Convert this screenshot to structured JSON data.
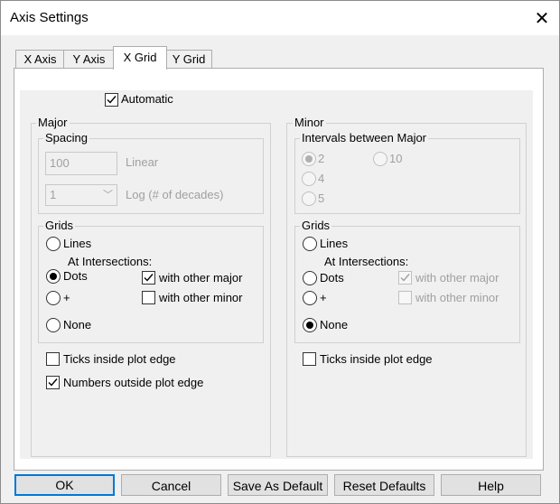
{
  "window": {
    "title": "Axis Settings"
  },
  "tabs": [
    {
      "label": "X Axis"
    },
    {
      "label": "Y Axis"
    },
    {
      "label": "X Grid"
    },
    {
      "label": "Y Grid"
    }
  ],
  "automatic": {
    "label": "Automatic",
    "checked": true
  },
  "major": {
    "title": "Major",
    "spacing": {
      "title": "Spacing",
      "linear_value": "100",
      "linear_label": "Linear",
      "log_value": "1",
      "log_label": "Log (# of decades)"
    },
    "grids": {
      "title": "Grids",
      "lines": "Lines",
      "at_intersections": "At Intersections:",
      "dots": "Dots",
      "plus": "+",
      "none": "None",
      "with_other_major": "with other major",
      "with_other_minor": "with other minor",
      "selected": "Dots"
    },
    "ticks_inside": "Ticks inside plot edge",
    "numbers_outside": "Numbers outside plot edge"
  },
  "minor": {
    "title": "Minor",
    "intervals": {
      "title": "Intervals between Major",
      "options": [
        "2",
        "4",
        "5",
        "10"
      ],
      "selected": "2"
    },
    "grids": {
      "title": "Grids",
      "lines": "Lines",
      "at_intersections": "At Intersections:",
      "dots": "Dots",
      "plus": "+",
      "none": "None",
      "with_other_major": "with other major",
      "with_other_minor": "with other minor",
      "selected": "None"
    },
    "ticks_inside": "Ticks inside plot edge"
  },
  "buttons": {
    "ok": "OK",
    "cancel": "Cancel",
    "save_default": "Save As Default",
    "reset_defaults": "Reset Defaults",
    "help": "Help"
  }
}
